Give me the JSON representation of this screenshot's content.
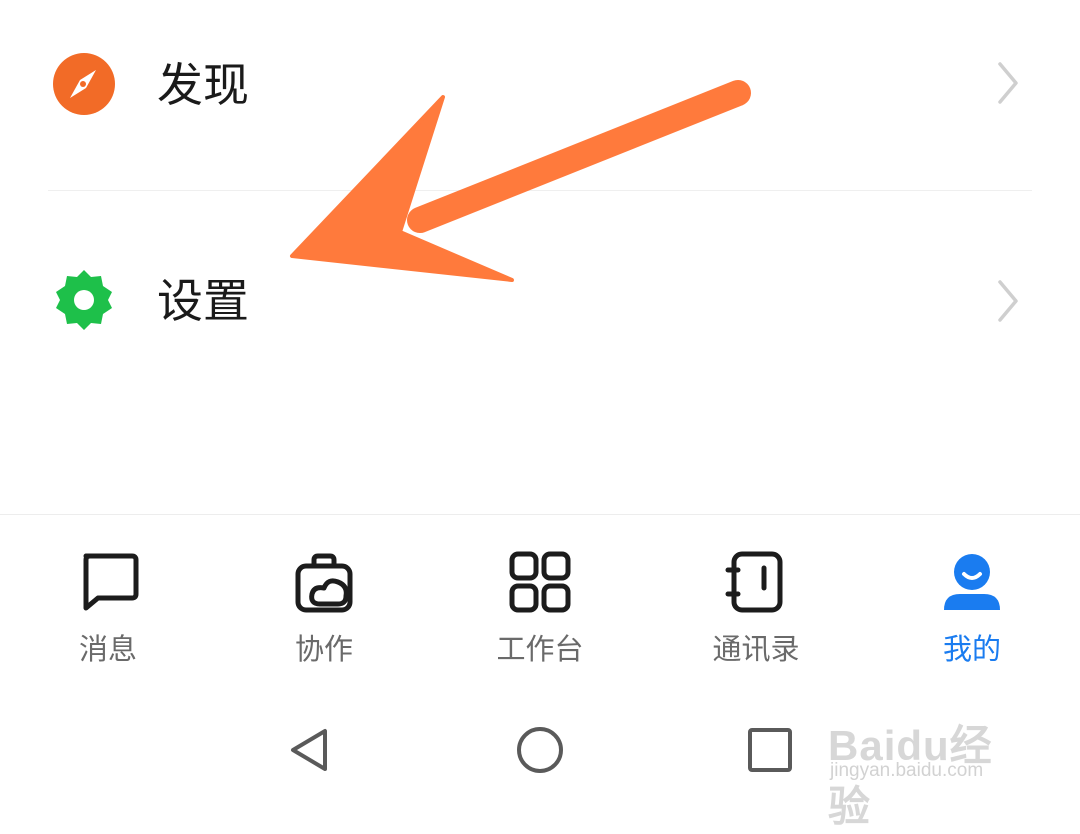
{
  "menu": {
    "items": [
      {
        "label": "发现",
        "icon": "compass-icon",
        "color": "#f26b27"
      },
      {
        "label": "设置",
        "icon": "gear-icon",
        "color": "#1ec04a"
      }
    ]
  },
  "annotation": {
    "arrow_color": "#ff7a3c",
    "points_to": "设置"
  },
  "tabbar": {
    "tabs": [
      {
        "label": "消息",
        "icon": "message-icon",
        "active": false
      },
      {
        "label": "协作",
        "icon": "collaboration-icon",
        "active": false
      },
      {
        "label": "工作台",
        "icon": "workbench-grid-icon",
        "active": false
      },
      {
        "label": "通讯录",
        "icon": "contacts-icon",
        "active": false
      },
      {
        "label": "我的",
        "icon": "profile-icon",
        "active": true
      }
    ],
    "active_color": "#1a7cf0",
    "inactive_color": "#6a6a6a"
  },
  "system_nav": {
    "buttons": [
      "back-icon",
      "home-icon",
      "recents-icon"
    ]
  },
  "watermark": {
    "logo": "Baidu经验",
    "url": "jingyan.baidu.com"
  }
}
